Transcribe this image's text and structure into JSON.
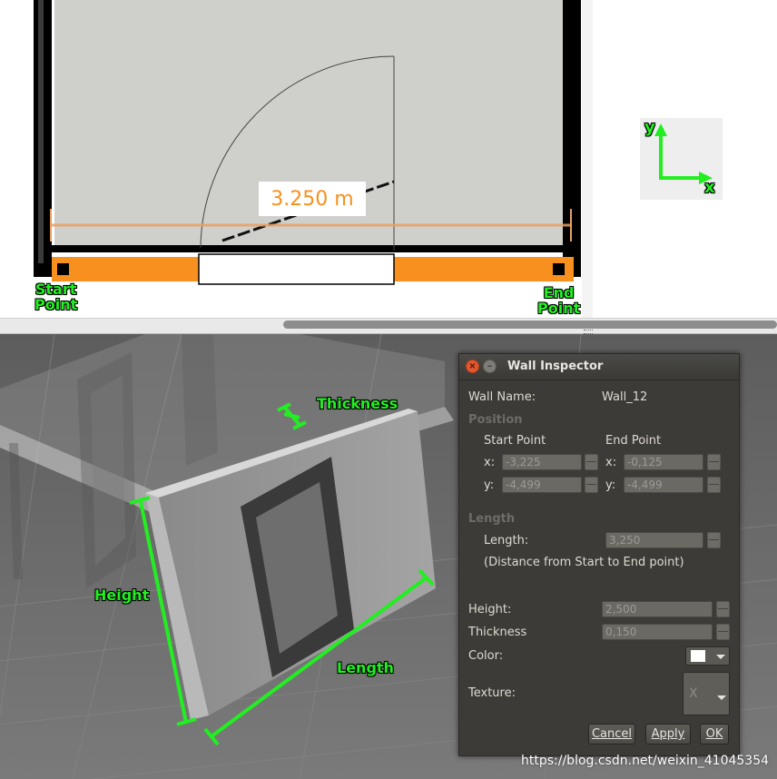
{
  "plan_view": {
    "measurement": "3.250 m",
    "start_point_label": "Start\nPoint",
    "end_point_label": "End\nPoint",
    "axis_y": "y",
    "axis_x": "x",
    "colors": {
      "wall_orange": "#f7901e",
      "measure_line": "#e8a064",
      "axis_green": "#22ee22"
    }
  },
  "scene_view": {
    "thickness_label": "Thickness",
    "height_label": "Height",
    "length_label": "Length",
    "colors": {
      "annotation_green": "#22ee22"
    }
  },
  "dialog": {
    "title": "Wall Inspector",
    "wall_name_label": "Wall Name:",
    "wall_name_value": "Wall_12",
    "position_section": "Position",
    "start_point_header": "Start Point",
    "end_point_header": "End Point",
    "x_label": "x:",
    "y_label": "y:",
    "start_x": "-3,225",
    "start_y": "-4,499",
    "end_x": "-0,125",
    "end_y": "-4,499",
    "length_section": "Length",
    "length_label": "Length:",
    "length_value": "3,250",
    "length_note": "(Distance from Start to End point)",
    "height_label": "Height:",
    "height_value": "2,500",
    "thickness_label": "Thickness",
    "thickness_value": "0,150",
    "color_label": "Color:",
    "color_value": "#ffffff",
    "texture_label": "Texture:",
    "texture_value": "X",
    "cancel_label": "Cancel",
    "apply_label": "Apply",
    "ok_label": "OK"
  },
  "watermark": "https://blog.csdn.net/weixin_41045354"
}
